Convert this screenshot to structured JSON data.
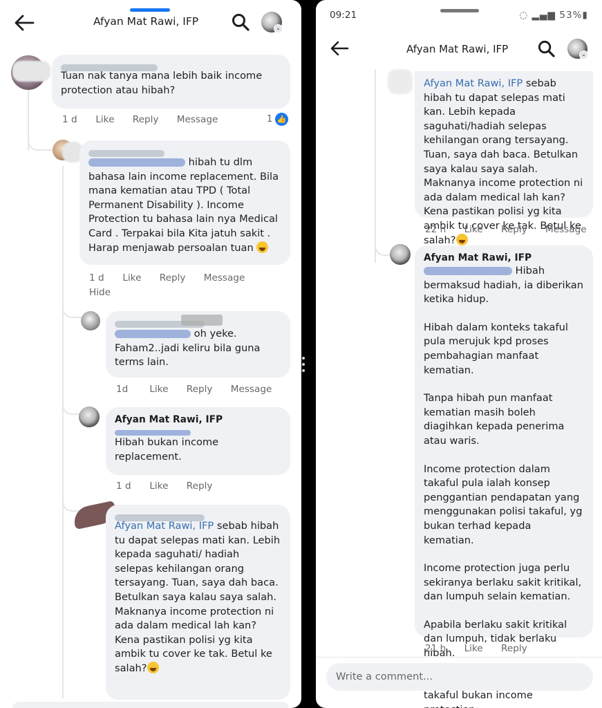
{
  "left": {
    "header_title": "Afyan Mat Rawi, IFP",
    "comments": [
      {
        "text": "Tuan nak tanya mana lebih baik income protection atau hibah?",
        "time": "1 d",
        "like": "Like",
        "reply": "Reply",
        "message": "Message",
        "reaction_count": "1"
      },
      {
        "text": "hibah tu dlm bahasa lain income replacement. Bila mana kematian atau TPD ( Total Permanent Disability ). Income Protection tu bahasa lain nya Medical Card . Terpakai bila Kita jatuh sakit . Harap menjawab persoalan tuan",
        "time": "1 d",
        "like": "Like",
        "reply": "Reply",
        "message": "Message",
        "hide": "Hide"
      },
      {
        "text": "oh yeke. Faham2..jadi keliru bila guna terms lain.",
        "time": "1d",
        "like": "Like",
        "reply": "Reply",
        "message": "Message"
      },
      {
        "author": "Afyan Mat Rawi, IFP",
        "text": "Hibah bukan income replacement.",
        "time": "1 d",
        "like": "Like",
        "reply": "Reply"
      },
      {
        "mention": "Afyan Mat Rawi, IFP",
        "text": "sebab hibah tu dapat selepas mati kan. Lebih kepada saguhati/ hadiah selepas kehilangan orang tersayang. Tuan, saya dah baca. Betulkan saya kalau saya salah. Maknanya income protection ni ada dalam medical lah kan? Kena pastikan polisi yg kita ambik tu cover ke tak. Betul ke salah?"
      }
    ]
  },
  "right": {
    "status_time": "09:21",
    "battery": "53%",
    "header_title": "Afyan Mat Rawi, IFP",
    "comment1": {
      "mention": "Afyan Mat Rawi, IFP",
      "text": "sebab hibah tu dapat selepas mati kan. Lebih kepada saguhati/hadiah selepas kehilangan orang tersayang. Tuan, saya dah baca. Betulkan saya kalau saya salah. Maknanya income protection ni ada dalam medical lah kan? Kena pastikan polisi yg kita ambik tu cover ke tak. Betul ke salah?",
      "time": "22 h",
      "like": "Like",
      "reply": "Reply",
      "message": "Message"
    },
    "comment2": {
      "author": "Afyan Mat Rawi, IFP",
      "p1": "Hibah bermaksud hadiah, ia diberikan ketika hidup.",
      "p2": "Hibah dalam konteks takaful pula merujuk kpd proses pembahagian manfaat kematian.",
      "p3": "Tanpa hibah pun manfaat kematian masih boleh diagihkan kepada penerima atau waris.",
      "p4": "Income protection dalam takaful pula ialah konsep penggantian pendapatan yang menggunakan polisi takaful, yg bukan terhad kepada kematian.",
      "p5": "Income protection juga perlu sekiranya berlaku sakit kritikal, dan lumpuh selain kematian.",
      "p6": "Apabila berlaku sakit kritikal dan lumpuh, tidak berlaku hibah.",
      "p7": "Sebab itu saya katakan hibah takaful bukan income protection.",
      "time": "21 h",
      "like": "Like",
      "reply": "Reply"
    },
    "input_placeholder": "Write a comment..."
  },
  "colors": {
    "mention": "#3a6fb0",
    "bubble": "#eff1f4",
    "meta": "#65676b",
    "like_badge": "#1877f2",
    "handle": "#1877f2"
  },
  "icons": [
    "back-arrow-icon",
    "search-icon",
    "chevron-down-icon",
    "like-reaction-icon",
    "wifi-icon",
    "signal-icon",
    "battery-icon"
  ]
}
